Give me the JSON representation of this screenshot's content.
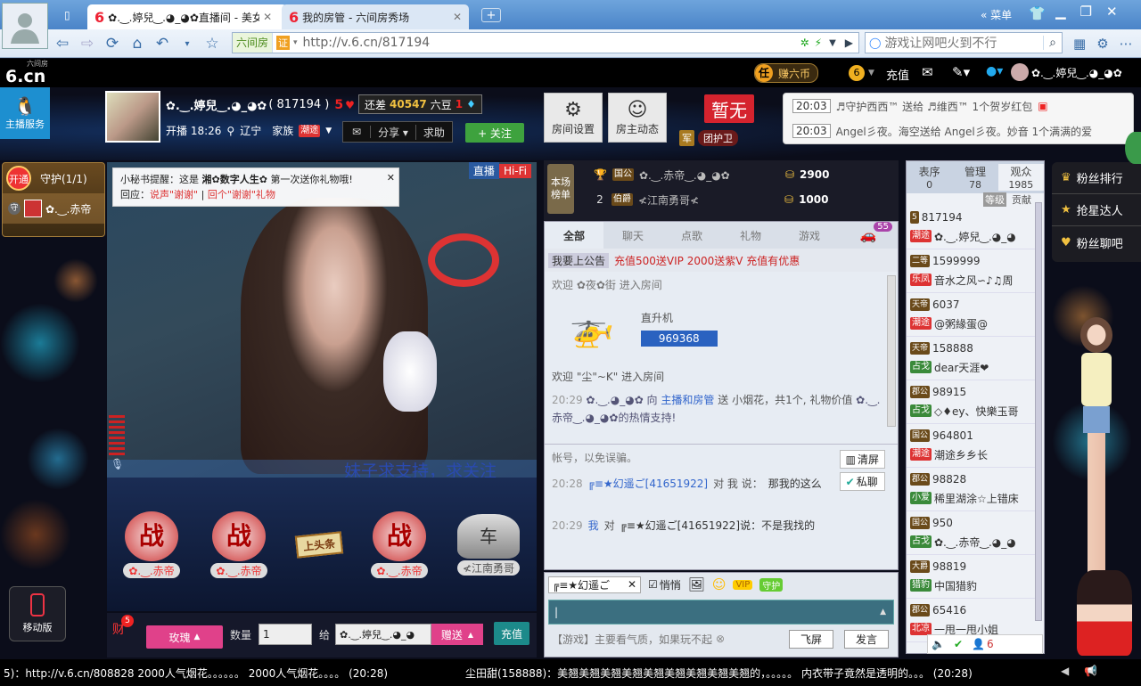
{
  "browser": {
    "tabs": [
      {
        "label": "✿.‿.婷兒‿.◕_◕✿直播间 - 美女",
        "logo": "6"
      },
      {
        "label": "我的房管 - 六间房秀场",
        "logo": "6"
      }
    ],
    "menu_label": "菜单",
    "site_badge": "六间房",
    "cert_badge": "证",
    "url": "http://v.6.cn/817194",
    "search_placeholder": "游戏让网吧火到不行"
  },
  "site": {
    "logo": "6.cn",
    "logo_small": "六间房",
    "coin_button": "赚六币",
    "coin_badge": "任",
    "recharge": "充值",
    "user_name": "✿.‿.婷兒‿.◕_◕✿",
    "level_badge": "6"
  },
  "host": {
    "kefu_label": "主播服务",
    "name": "✿.‿.婷兒‿.◕_◕✿",
    "room_id": "( 817194 )",
    "level": "5",
    "remain_label": "还差",
    "remain_value": "40547",
    "remain_unit": "六豆",
    "next_level": "1",
    "start_time": "开播 18:26",
    "location": "辽宁",
    "family_label": "家族",
    "family_badge": "潮途",
    "share_label": "分享",
    "help_label": "求助",
    "follow_label": "+ 关注",
    "room_settings": "房间设置",
    "owner_dynamic": "房主动态",
    "status_banner": "暂无",
    "guard_group": "团护卫",
    "army_badge": "军"
  },
  "broadcasts": [
    {
      "time": "20:03",
      "text": "♬守护西西™ 送给 ♬维西™ 1个贺岁红包"
    },
    {
      "time": "20:03",
      "text": "Angel彡夜。海空送给 Angel彡夜。妙音 1个满满的爱"
    }
  ],
  "guard": {
    "open_label": "开通",
    "title": "守护(1/1)",
    "member": "✿.‿.赤帝",
    "guard_icon": "守"
  },
  "video": {
    "notice_title": "小秘书提醒：这是",
    "notice_name": "湘✿数字人生✿",
    "notice_suffix": "第一次送你礼物哦!",
    "notice_reply_label": "回应：",
    "notice_reply1": "说声\"谢谢\"",
    "notice_reply2": "回个\"谢谢\"礼物",
    "live_tag": "直播",
    "hifi_tag": "Hi-Fi",
    "marquee": "妹子求支持，求关注"
  },
  "gift_row": [
    {
      "name": "✿.‿.赤帝",
      "icon": "战"
    },
    {
      "name": "✿.‿.赤帝",
      "icon": "战"
    },
    {
      "name": "上头条",
      "icon": "上头条"
    },
    {
      "name": "✿.‿.赤帝",
      "icon": "战"
    },
    {
      "name": "≮江南勇哥",
      "icon": "车"
    }
  ],
  "send": {
    "gift_badge": "5",
    "gift_icon": "财",
    "gift_name": "玫瑰",
    "qty_label": "数量",
    "qty_value": "1",
    "to_label": "给",
    "to_value": "✿.‿.婷兒‿.◕_◕",
    "send_label": "赠送",
    "recharge_label": "充值",
    "mobile_label": "移动版"
  },
  "rank": {
    "box_label": "本场榜单",
    "rows": [
      {
        "pos": "1",
        "badge": "国公",
        "name": "✿.‿.赤帝‿.◕_◕✿",
        "score": "2900"
      },
      {
        "pos": "2",
        "badge": "伯爵",
        "name": "≮江南勇哥≮",
        "score": "1000"
      }
    ]
  },
  "chat": {
    "tabs": [
      "全部",
      "聊天",
      "点歌",
      "礼物",
      "游戏"
    ],
    "car_count": "55",
    "pinned_label": "我要上公告",
    "pinned_text": "充值500送VIP 2000送紫V 充值有优惠",
    "welcome1": "欢迎 ✿夜✿街 进入房间",
    "heli_name": "直升机",
    "heli_count": "969368",
    "welcome2": "欢迎 \"尘\"~K\" 进入房间",
    "gift_time": "20:29",
    "gift_msg_pre": "✿.‿.◕_◕✿ 向",
    "gift_msg_host": "主播和房管",
    "gift_msg_send": "送",
    "gift_msg_item": "小烟花，共1个, 礼物价值",
    "gift_msg_thanks": "✿.‿.赤帝‿.◕_◕✿的热情支持!",
    "private_clear": "清屏",
    "private_chat": "私聊",
    "private_line0": "帐号，以免误骗。",
    "private_msgs": [
      {
        "time": "20:28",
        "from": "╔≡★幻遥ご[41651922]",
        "mid": "对 我 说：",
        "text": "那我的这么"
      },
      {
        "time": "20:29",
        "from": "我",
        "mid": "对",
        "text": "╔≡★幻遥ご[41651922]说：不是我找的"
      }
    ],
    "target": "╔≡★幻遥ご",
    "whisper_label": "悄悄",
    "vip_label": "VIP",
    "guard_label": "守护",
    "game_tip": "【游戏】主要看气质，如果玩不起",
    "fly_label": "飞屏",
    "send_label": "发言"
  },
  "userlist": {
    "tabs": [
      {
        "label": "表序",
        "count": "0"
      },
      {
        "label": "管理",
        "count": "78"
      },
      {
        "label": "观众",
        "count": "1985"
      }
    ],
    "sort1": "等级",
    "sort2": "贡献",
    "rows": [
      {
        "lvl": "5",
        "id": "817194",
        "badge": "潮途",
        "badge_color": "#d33",
        "name": "✿.‿.婷兒‿.◕_◕"
      },
      {
        "lvl": "二等",
        "id": "1599999",
        "badge": "乐凤",
        "badge_color": "#d33",
        "name": "音水之风∽♪♫周"
      },
      {
        "lvl": "天帝",
        "id": "6037",
        "badge": "潮途",
        "badge_color": "#d33",
        "name": "@粥緣蛋@"
      },
      {
        "lvl": "天帝",
        "id": "158888",
        "badge": "占戈",
        "badge_color": "#3a8a3a",
        "name": "dear天涯❤"
      },
      {
        "lvl": "郡公",
        "id": "98915",
        "badge": "占戈",
        "badge_color": "#3a8a3a",
        "name": "◇♦ey、快樂玉哥"
      },
      {
        "lvl": "国公",
        "id": "964801",
        "badge": "潮途",
        "badge_color": "#d33",
        "name": "潮途乡乡长"
      },
      {
        "lvl": "郡公",
        "id": "98828",
        "badge": "小爱",
        "badge_color": "#3a8a3a",
        "name": "稀里湖涂☆上错床"
      },
      {
        "lvl": "国公",
        "id": "950",
        "badge": "占戈",
        "badge_color": "#3a8a3a",
        "name": "✿.‿.赤帝‿.◕_◕"
      },
      {
        "lvl": "大爵",
        "id": "98819",
        "badge": "猎豹",
        "badge_color": "#3a8a3a",
        "name": "中国猎豹"
      },
      {
        "lvl": "郡公",
        "id": "65416",
        "badge": "北凉",
        "badge_color": "#d33",
        "name": "一甩一甩小姐"
      }
    ],
    "online_count": "6"
  },
  "fans": [
    {
      "label": "粉丝排行",
      "icon": "crown"
    },
    {
      "label": "抢星达人",
      "icon": "star"
    },
    {
      "label": "粉丝聊吧",
      "icon": "heart"
    }
  ],
  "ticker": {
    "left": "5)：http://v.6.cn/808828 2000人气烟花。。。。。。 2000人气烟花。。。。 (20:28)",
    "right": "尘田甜(158888)：美翘美翘美翘美翘美翘美翘美翘美翘美翘的，。。。。。 内衣带子竟然是透明的。。。 (20:28)"
  },
  "colors": {
    "accent": "#2c8ef0",
    "follow": "#3ea23e",
    "gift_pink": "#e0418a",
    "red": "#d5232e",
    "gold": "#f0c040"
  }
}
